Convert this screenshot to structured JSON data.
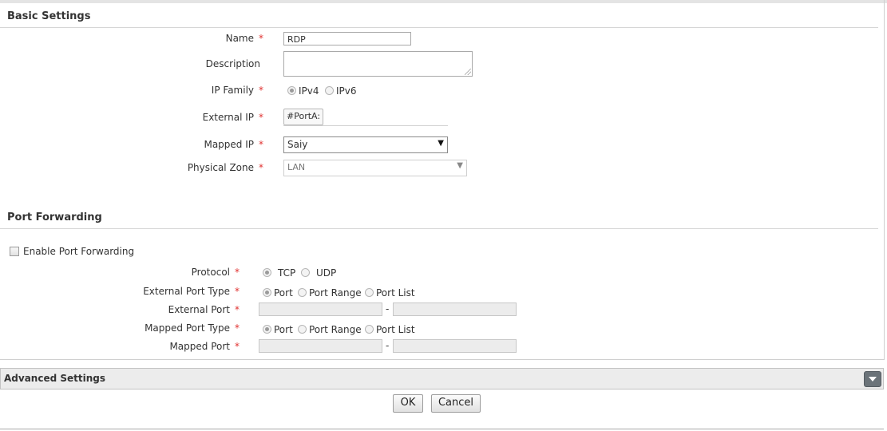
{
  "basic_settings": {
    "title": "Basic Settings",
    "name_label": "Name",
    "name_value": "RDP",
    "description_label": "Description",
    "description_value": "",
    "ip_family_label": "IP Family",
    "ip_family_options": [
      "IPv4",
      "IPv6"
    ],
    "ip_family_selected": "IPv4",
    "external_ip_label": "External IP",
    "external_ip_value": "#PortA:",
    "mapped_ip_label": "Mapped IP",
    "mapped_ip_value": "Saiy",
    "physical_zone_label": "Physical Zone",
    "physical_zone_value": "LAN",
    "required_mark": "*"
  },
  "port_forwarding": {
    "title": "Port Forwarding",
    "enable_label": "Enable Port Forwarding",
    "enabled": false,
    "protocol_label": "Protocol",
    "protocol_options": [
      "TCP",
      "UDP"
    ],
    "protocol_selected": "TCP",
    "external_port_type_label": "External Port Type",
    "port_type_options": [
      "Port",
      "Port Range",
      "Port List"
    ],
    "external_port_type_selected": "Port",
    "external_port_label": "External Port",
    "mapped_port_type_label": "Mapped Port Type",
    "mapped_port_type_selected": "Port",
    "mapped_port_label": "Mapped Port",
    "range_separator": "-"
  },
  "advanced_settings": {
    "title": "Advanced Settings",
    "toggle_icon": "chevron-down-icon"
  },
  "actions": {
    "ok_label": "OK",
    "cancel_label": "Cancel"
  },
  "colors": {
    "required": "#e0312f",
    "toggle_button": "#6b7379"
  }
}
